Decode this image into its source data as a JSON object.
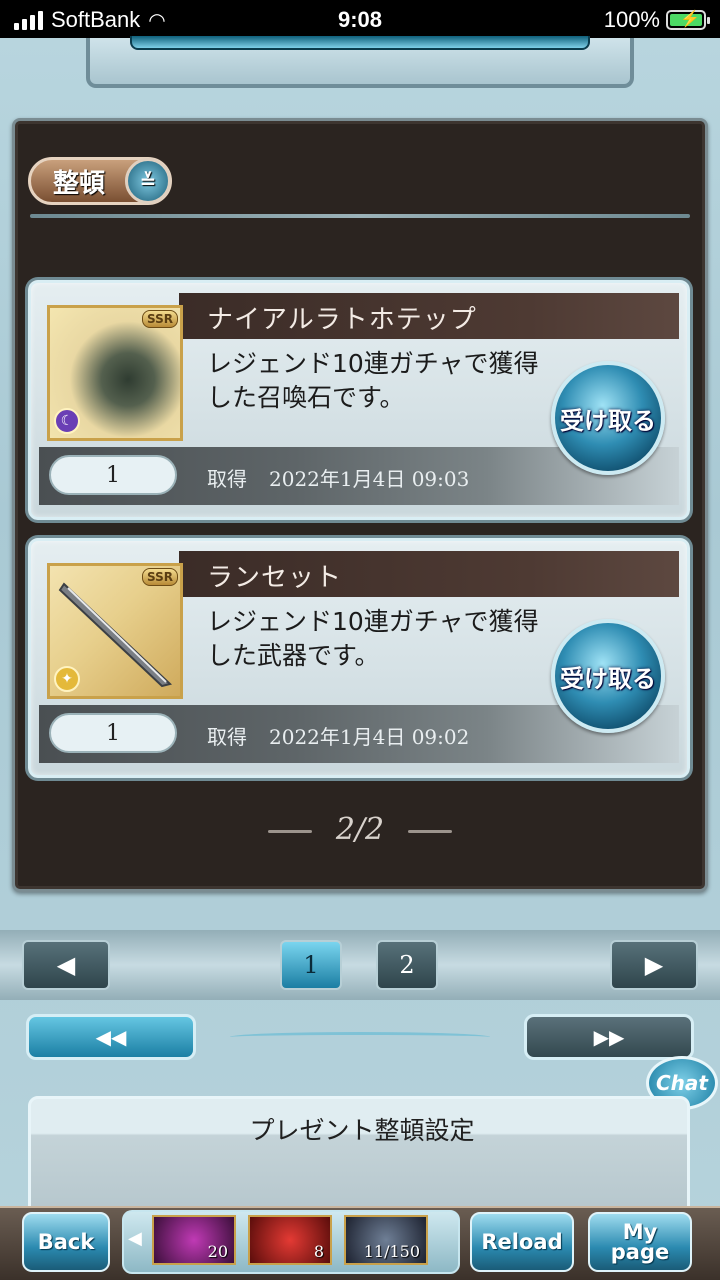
{
  "status_bar": {
    "carrier": "SoftBank",
    "time": "9:08",
    "battery": "100%"
  },
  "sort_button": {
    "label": "整頓",
    "icon": "chevron-down-icon"
  },
  "items": [
    {
      "name": "ナイアルラトホテップ",
      "rarity": "SSR",
      "element_icon": "dark-element-icon",
      "element_color": "#6a3fb5",
      "description": "レジェンド10連ガチャで獲得した召喚石です。",
      "quantity": "1",
      "acquired_label": "取得",
      "acquired_date": "2022年1月4日 09:03",
      "receive_label": "受け取る"
    },
    {
      "name": "ランセット",
      "rarity": "SSR",
      "element_icon": "light-element-icon",
      "element_color": "#e4b93a",
      "description": "レジェンド10連ガチャで獲得した武器です。",
      "quantity": "1",
      "acquired_label": "取得",
      "acquired_date": "2022年1月4日 09:02",
      "receive_label": "受け取る"
    }
  ],
  "page_indicator": "2/2",
  "pager": {
    "prev_icon": "triangle-left-icon",
    "next_icon": "triangle-right-icon",
    "pages": [
      "1",
      "2"
    ],
    "active_page": "1",
    "first_icon": "double-left-icon",
    "last_icon": "double-right-icon"
  },
  "chat_label": "Chat",
  "settings": {
    "title": "プレゼント整頓設定"
  },
  "bottom_nav": {
    "back_label": "Back",
    "reload_label": "Reload",
    "mypage_label": "My page",
    "items": [
      "20",
      "8",
      "11/150"
    ]
  },
  "colors": {
    "accent": "#2f8db3",
    "panel_dark": "#2b2420"
  }
}
